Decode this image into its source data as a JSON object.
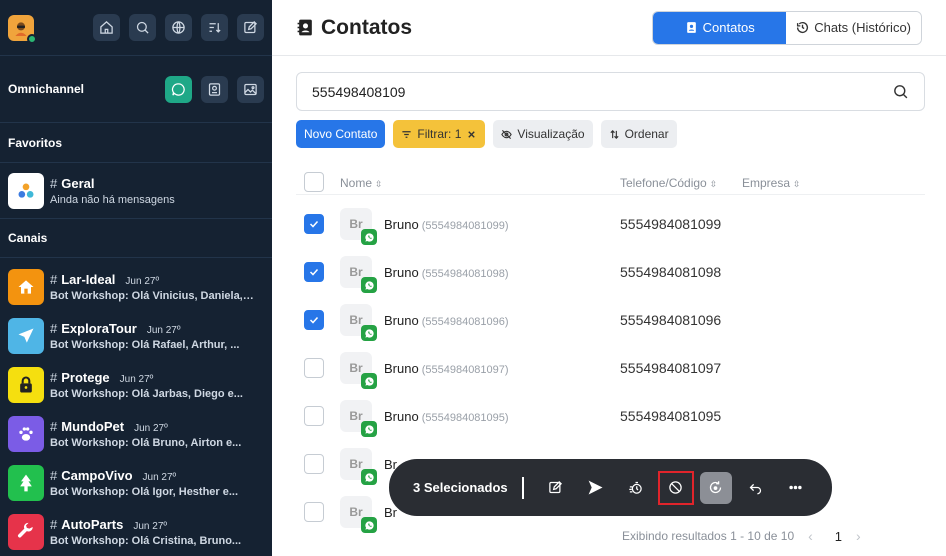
{
  "sidebar": {
    "omnichannel_title": "Omnichannel",
    "favorites_title": "Favoritos",
    "canais_title": "Canais",
    "favorites": [
      {
        "name": "Geral",
        "preview": "Ainda não há mensagens"
      }
    ],
    "channels": [
      {
        "name": "Lar-Ideal",
        "date": "Jun 27º",
        "preview": "Bot Workshop: Olá Vinicius, Daniela, Ana...",
        "color": "#f3930f",
        "icon": "house-icon"
      },
      {
        "name": "ExploraTour",
        "date": "Jun 27º",
        "preview": "Bot Workshop: Olá Rafael, Arthur, ...",
        "color": "#4fb5e6",
        "icon": "airplane-icon"
      },
      {
        "name": "Protege",
        "date": "Jun 27º",
        "preview": "Bot Workshop: Olá Jarbas, Diego e...",
        "color": "#f5df0f",
        "icon": "lock-icon"
      },
      {
        "name": "MundoPet",
        "date": "Jun 27º",
        "preview": "Bot Workshop: Olá Bruno, Airton e...",
        "color": "#7b5ce6",
        "icon": "paw-icon"
      },
      {
        "name": "CampoVivo",
        "date": "Jun 27º",
        "preview": "Bot Workshop: Olá Igor, Hesther e...",
        "color": "#22c04e",
        "icon": "tree-icon"
      },
      {
        "name": "AutoParts",
        "date": "Jun 27º",
        "preview": "Bot Workshop: Olá Cristina, Bruno...",
        "color": "#e6334a",
        "icon": "wrench-icon"
      }
    ]
  },
  "header": {
    "title": "Contatos",
    "tab_contatos": "Contatos",
    "tab_chats": "Chats (Histórico)"
  },
  "search": {
    "value": "555498408109"
  },
  "toolbar": {
    "new_contact": "Novo Contato",
    "filter": "Filtrar: 1",
    "view": "Visualização",
    "sort": "Ordenar"
  },
  "table": {
    "col_name": "Nome",
    "col_phone": "Telefone/Código",
    "col_company": "Empresa",
    "rows": [
      {
        "avatar": "Br",
        "name": "Bruno",
        "code": "(5554984081099)",
        "phone": "5554984081099",
        "checked": true
      },
      {
        "avatar": "Br",
        "name": "Bruno",
        "code": "(5554984081098)",
        "phone": "5554984081098",
        "checked": true
      },
      {
        "avatar": "Br",
        "name": "Bruno",
        "code": "(5554984081096)",
        "phone": "5554984081096",
        "checked": true
      },
      {
        "avatar": "Br",
        "name": "Bruno",
        "code": "(5554984081097)",
        "phone": "5554984081097",
        "checked": false
      },
      {
        "avatar": "Br",
        "name": "Bruno",
        "code": "(5554984081095)",
        "phone": "5554984081095",
        "checked": false
      },
      {
        "avatar": "Br",
        "name": "Br",
        "code": "",
        "phone": "",
        "checked": false
      },
      {
        "avatar": "Br",
        "name": "Br",
        "code": "",
        "phone": "",
        "checked": false
      }
    ]
  },
  "bulk": {
    "selected_label": "3 Selecionados"
  },
  "pager": {
    "summary": "Exibindo resultados 1 - 10 de 10",
    "page": "1",
    "prev": "‹",
    "next": "›"
  }
}
